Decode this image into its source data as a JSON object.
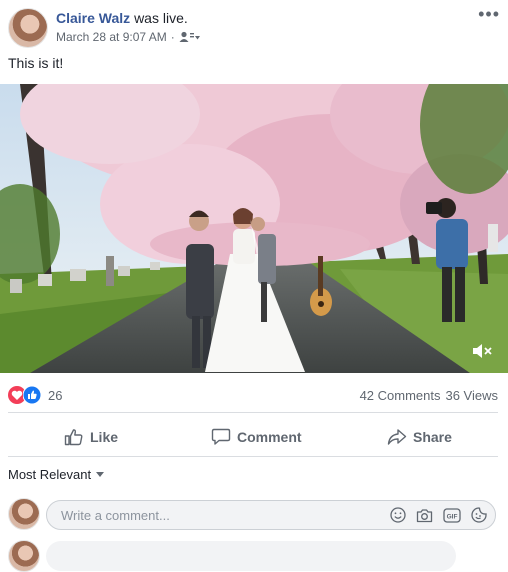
{
  "post": {
    "author": "Claire Walz",
    "verb": "was live.",
    "timestamp": "March 28 at 9:07 AM",
    "separator": "·",
    "text": "This is it!",
    "icons": {
      "audience": "friends-audience-icon",
      "more": "more-options-icon",
      "mute": "volume-muted-icon"
    }
  },
  "engagement": {
    "reaction_count": "26",
    "comments": "42 Comments",
    "views": "36 Views",
    "reactions": [
      "love",
      "like"
    ]
  },
  "actions": {
    "like": "Like",
    "comment": "Comment",
    "share": "Share"
  },
  "comments_section": {
    "sort_label": "Most Relevant",
    "placeholder": "Write a comment..."
  },
  "colors": {
    "brand_link": "#385898",
    "like_blue": "#1877f2",
    "love_red": "#f33e58",
    "muted_text": "#606770"
  }
}
